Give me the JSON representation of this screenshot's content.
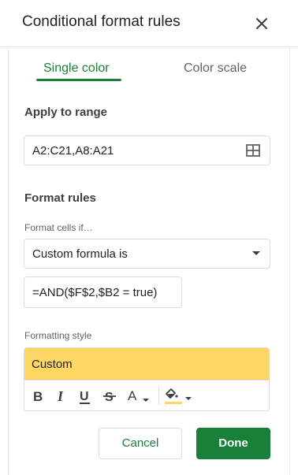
{
  "dialog": {
    "title": "Conditional format rules",
    "close_icon": "close-icon"
  },
  "tabs": [
    {
      "label": "Single color",
      "active": true
    },
    {
      "label": "Color scale",
      "active": false
    }
  ],
  "apply_to_range": {
    "heading": "Apply to range",
    "value": "A2:C21,A8:A21",
    "icon": "grid-select-icon"
  },
  "format_rules": {
    "heading": "Format rules",
    "condition_label": "Format cells if…",
    "condition_value": "Custom formula is",
    "formula_value": "=AND($F$2,$B2 = true)"
  },
  "formatting_style": {
    "label": "Formatting style",
    "preset_label": "Custom",
    "preview_color": "#fdd663",
    "fill_color": "#fdd663",
    "toolbar": [
      {
        "name": "bold",
        "icon": "bold-icon"
      },
      {
        "name": "italic",
        "icon": "italic-icon"
      },
      {
        "name": "underline",
        "icon": "underline-icon"
      },
      {
        "name": "strikethrough",
        "icon": "strikethrough-icon"
      },
      {
        "name": "text-color",
        "icon": "text-color-icon"
      },
      {
        "name": "fill-color",
        "icon": "fill-color-icon"
      }
    ]
  },
  "actions": {
    "cancel_label": "Cancel",
    "done_label": "Done"
  },
  "colors": {
    "accent": "#188038",
    "preview": "#fdd663"
  }
}
